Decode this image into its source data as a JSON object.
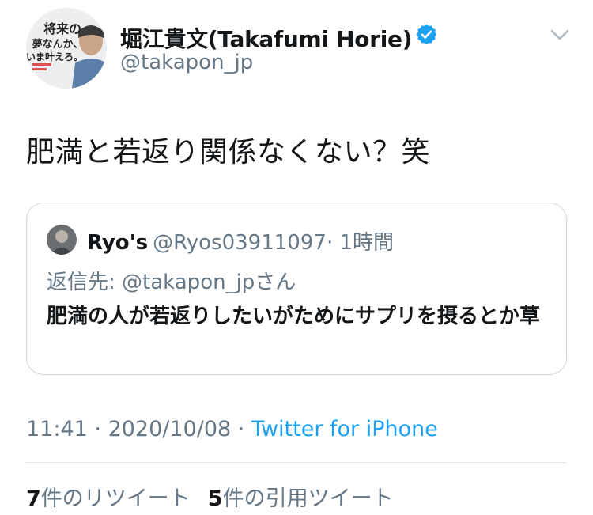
{
  "author": {
    "name": "堀江貴文(Takafumi Horie)",
    "handle": "@takapon_jp",
    "verified": true,
    "avatar_text": {
      "line1": "将来の",
      "line2": "夢なんか、",
      "line3": "いま叶えろ。"
    }
  },
  "tweet": {
    "text": "肥満と若返り関係なくない？笑"
  },
  "quoted_tweet": {
    "name": "Ryo's",
    "handle": "@Ryos03911097",
    "time": "· 1時間",
    "reply_to": "返信先: @takapon_jpさん",
    "text": "肥満の人が若返りしたいがためにサプリを摂るとか草"
  },
  "meta": {
    "time": "11:41",
    "date": "2020/10/08",
    "separator": " · ",
    "source": "Twitter for iPhone"
  },
  "stats": {
    "retweets_count": "7",
    "retweets_label": "件のリツイート",
    "quotes_count": "5",
    "quotes_label": "件の引用ツイート"
  },
  "colors": {
    "primary_text": "#14171a",
    "secondary_text": "#657786",
    "link": "#1da1f2",
    "border": "#ccd6dd"
  },
  "icons": [
    "verified-icon",
    "chevron-down-icon"
  ]
}
